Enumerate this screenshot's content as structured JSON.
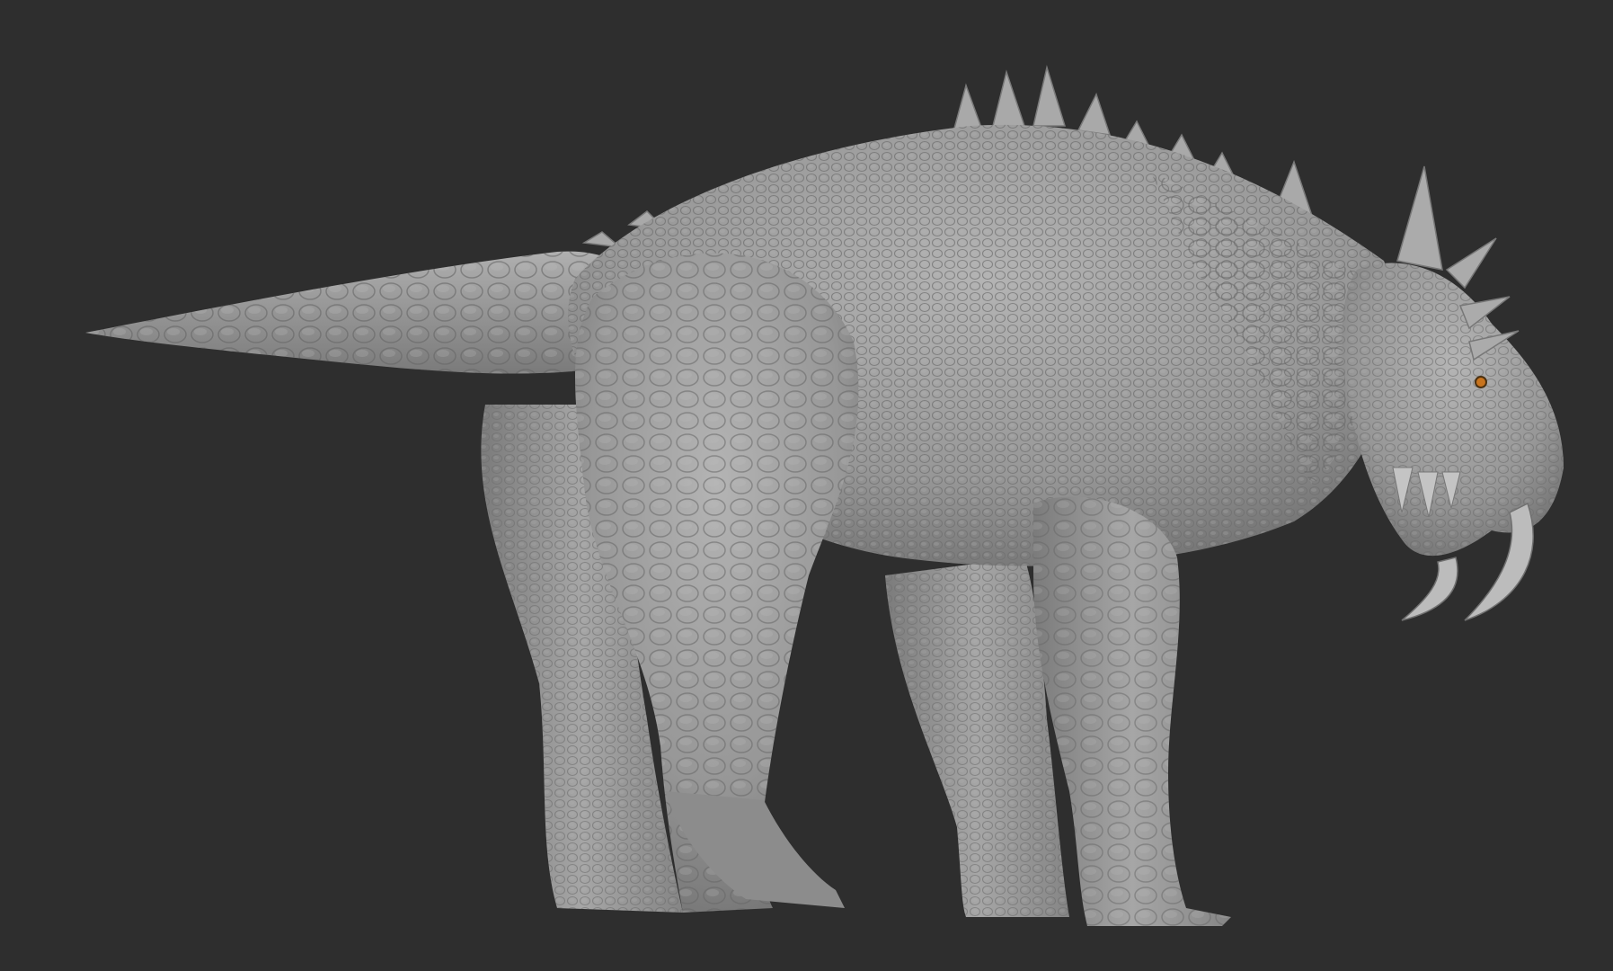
{
  "viewport": {
    "background_color": "#2e2e2e"
  },
  "sculpt": {
    "subject": "creature-sculpt",
    "material_color": "#9a9a9a",
    "eye_color": "#c8741e"
  }
}
